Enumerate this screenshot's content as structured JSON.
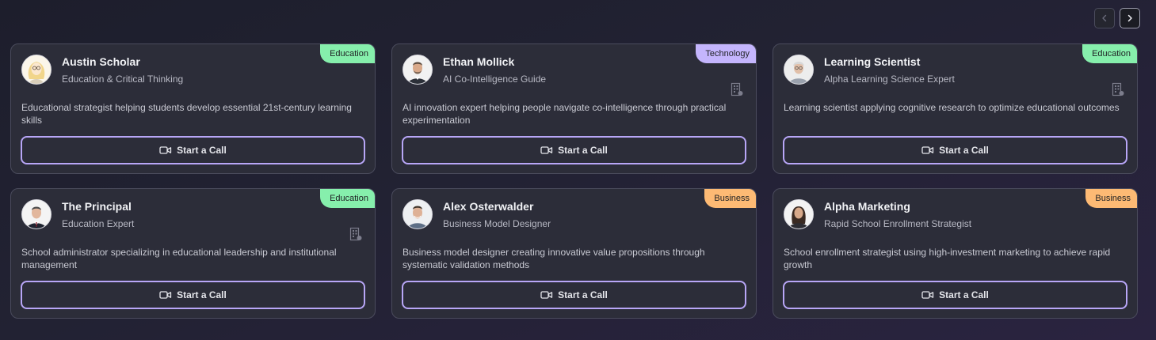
{
  "pagination": {
    "prev_icon": "chevron-left-icon",
    "next_icon": "chevron-right-icon"
  },
  "colors": {
    "button_border": "#b8a6f7",
    "education": "#86efac",
    "technology": "#c4b5fd",
    "business": "#fdba74"
  },
  "cards": [
    {
      "name": "Austin Scholar",
      "role": "Education & Critical Thinking",
      "category": "Education",
      "description": "Educational strategist helping students develop essential 21st-century learning skills",
      "button_label": "Start a Call",
      "has_building_icon": false
    },
    {
      "name": "Ethan Mollick",
      "role": "AI Co-Intelligence Guide",
      "category": "Technology",
      "description": "AI innovation expert helping people navigate co-intelligence through practical experimentation",
      "button_label": "Start a Call",
      "has_building_icon": true
    },
    {
      "name": "Learning Scientist",
      "role": "Alpha Learning Science Expert",
      "category": "Education",
      "description": "Learning scientist applying cognitive research to optimize educational outcomes",
      "button_label": "Start a Call",
      "has_building_icon": true
    },
    {
      "name": "The Principal",
      "role": "Education Expert",
      "category": "Education",
      "description": "School administrator specializing in educational leadership and institutional management",
      "button_label": "Start a Call",
      "has_building_icon": true
    },
    {
      "name": "Alex Osterwalder",
      "role": "Business Model Designer",
      "category": "Business",
      "description": "Business model designer creating innovative value propositions through systematic validation methods",
      "button_label": "Start a Call",
      "has_building_icon": false
    },
    {
      "name": "Alpha Marketing",
      "role": "Rapid School Enrollment Strategist",
      "category": "Business",
      "description": "School enrollment strategist using high-investment marketing to achieve rapid growth",
      "button_label": "Start a Call",
      "has_building_icon": false
    }
  ]
}
